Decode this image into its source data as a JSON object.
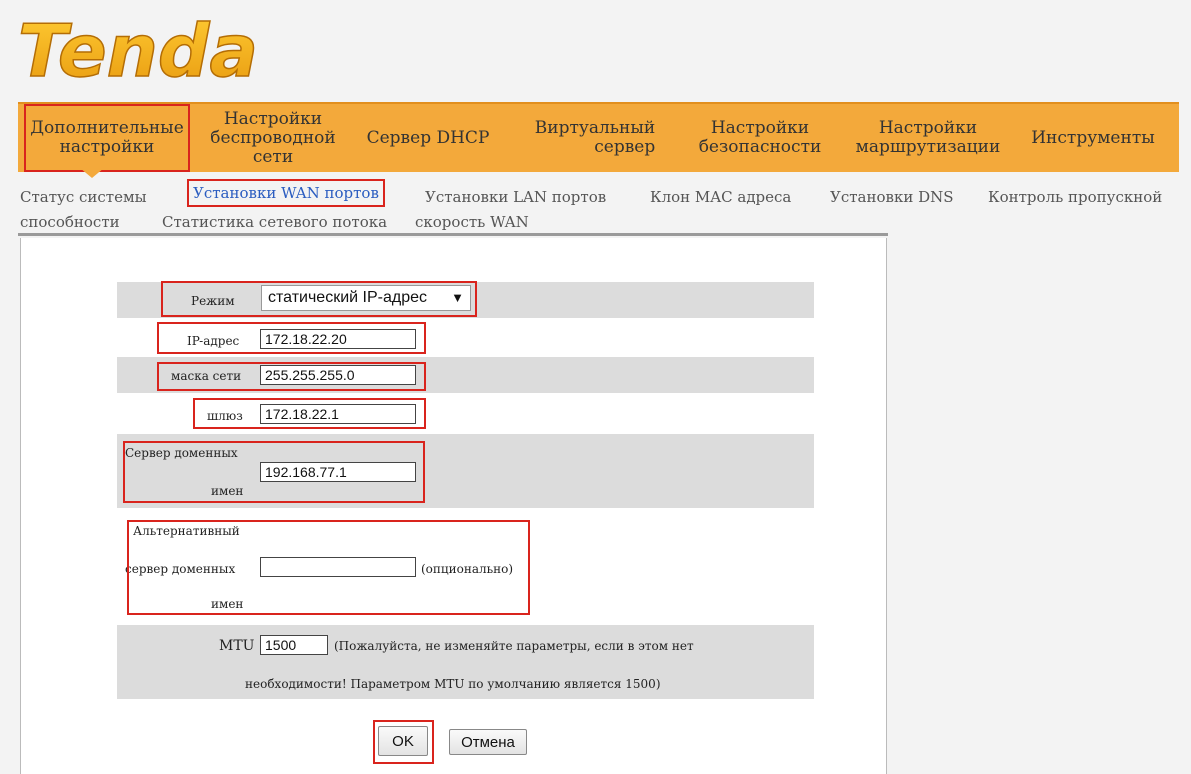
{
  "brand": {
    "logo_text": "Tenda"
  },
  "nav": {
    "items": [
      {
        "line1": "Дополнительные",
        "line2": "настройки",
        "line3": ""
      },
      {
        "line1": "Настройки",
        "line2": "беспроводной",
        "line3": "сети"
      },
      {
        "line1": "Сервер DHCP",
        "line2": "",
        "line3": ""
      },
      {
        "line1": "Виртуальный",
        "line2": "сервер",
        "line3": ""
      },
      {
        "line1": "Настройки",
        "line2": "безопасности",
        "line3": ""
      },
      {
        "line1": "Настройки",
        "line2": "маршрутизации",
        "line3": ""
      },
      {
        "line1": "Инструменты",
        "line2": "",
        "line3": ""
      }
    ]
  },
  "subnav": {
    "items": [
      "Статус системы",
      "Установки WAN портов",
      "Установки LAN портов",
      "Клон MAC адреса",
      "Установки DNS",
      "Контроль пропускной",
      "способности",
      "Статистика сетевого потока",
      "скорость WAN"
    ]
  },
  "form": {
    "mode_label": "Режим",
    "mode_value": "статический IP-адрес",
    "ip_label": "IP-адрес",
    "ip_value": "172.18.22.20",
    "mask_label": "маска сети",
    "mask_value": "255.255.255.0",
    "gateway_label": "шлюз",
    "gateway_value": "172.18.22.1",
    "dns_label_1": "Сервер доменных",
    "dns_label_2": "имен",
    "dns_value": "192.168.77.1",
    "alt_dns_label_1": "Альтернативный",
    "alt_dns_label_2": "сервер доменных",
    "alt_dns_label_3": "имен",
    "alt_dns_value": "",
    "alt_dns_note": "(опционально)",
    "mtu_label": "MTU",
    "mtu_value": "1500",
    "mtu_note_1": "(Пожалуйста, не изменяйте параметры, если в этом нет",
    "mtu_note_2": "необходимости! Параметром MTU по умолчанию является 1500)"
  },
  "buttons": {
    "ok": "OK",
    "cancel": "Отмена"
  },
  "colors": {
    "nav_bg": "#f3a93b",
    "highlight": "#d9241d",
    "link_active": "#2a5cc0"
  }
}
